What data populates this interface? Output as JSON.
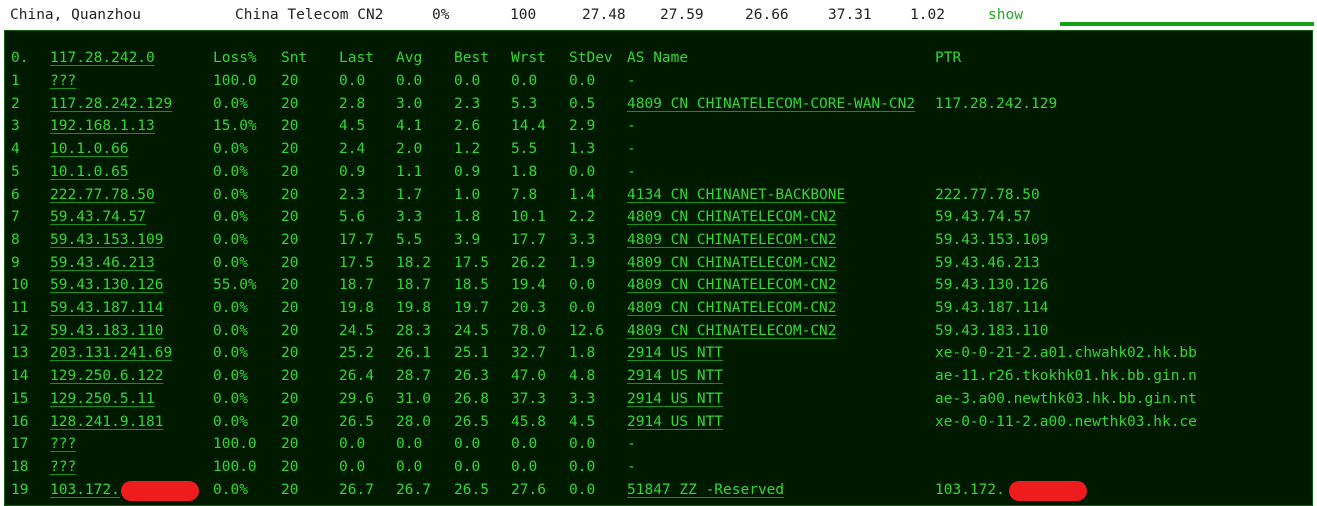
{
  "summary": {
    "location": "China, Quanzhou",
    "provider": "China Telecom CN2",
    "loss": "0%",
    "sent": "100",
    "last": "27.48",
    "avg": "27.59",
    "best": "26.66",
    "worst": "37.31",
    "stdev": "1.02",
    "show_label": "show",
    "accent": "#13a313"
  },
  "header": {
    "hop": "0.",
    "host": "117.28.242.0",
    "loss": "Loss%",
    "snt": "Snt",
    "last": "Last",
    "avg": "Avg",
    "best": "Best",
    "wrst": "Wrst",
    "stdev": "StDev",
    "asname": "AS Name",
    "ptr": "PTR"
  },
  "hops": [
    {
      "hop": "1",
      "host": "???",
      "loss": "100.0",
      "snt": "20",
      "last": "0.0",
      "avg": "0.0",
      "best": "0.0",
      "wrst": "0.0",
      "stdev": "0.0",
      "as": "-",
      "ptr": ""
    },
    {
      "hop": "2",
      "host": "117.28.242.129",
      "loss": "0.0%",
      "snt": "20",
      "last": "2.8",
      "avg": "3.0",
      "best": "2.3",
      "wrst": "5.3",
      "stdev": "0.5",
      "as": "4809  CN CHINATELECOM-CORE-WAN-CN2",
      "ptr": "117.28.242.129"
    },
    {
      "hop": "3",
      "host": "192.168.1.13",
      "loss": "15.0%",
      "snt": "20",
      "last": "4.5",
      "avg": "4.1",
      "best": "2.6",
      "wrst": "14.4",
      "stdev": "2.9",
      "as": "-",
      "ptr": ""
    },
    {
      "hop": "4",
      "host": "10.1.0.66",
      "loss": "0.0%",
      "snt": "20",
      "last": "2.4",
      "avg": "2.0",
      "best": "1.2",
      "wrst": "5.5",
      "stdev": "1.3",
      "as": "-",
      "ptr": ""
    },
    {
      "hop": "5",
      "host": "10.1.0.65",
      "loss": "0.0%",
      "snt": "20",
      "last": "0.9",
      "avg": "1.1",
      "best": "0.9",
      "wrst": "1.8",
      "stdev": "0.0",
      "as": "-",
      "ptr": ""
    },
    {
      "hop": "6",
      "host": "222.77.78.50",
      "loss": "0.0%",
      "snt": "20",
      "last": "2.3",
      "avg": "1.7",
      "best": "1.0",
      "wrst": "7.8",
      "stdev": "1.4",
      "as": "4134  CN CHINANET-BACKBONE",
      "ptr": "222.77.78.50"
    },
    {
      "hop": "7",
      "host": "59.43.74.57",
      "loss": "0.0%",
      "snt": "20",
      "last": "5.6",
      "avg": "3.3",
      "best": "1.8",
      "wrst": "10.1",
      "stdev": "2.2",
      "as": "4809  CN CHINATELECOM-CN2",
      "ptr": "59.43.74.57"
    },
    {
      "hop": "8",
      "host": "59.43.153.109",
      "loss": "0.0%",
      "snt": "20",
      "last": "17.7",
      "avg": "5.5",
      "best": "3.9",
      "wrst": "17.7",
      "stdev": "3.3",
      "as": "4809  CN CHINATELECOM-CN2",
      "ptr": "59.43.153.109"
    },
    {
      "hop": "9",
      "host": "59.43.46.213",
      "loss": "0.0%",
      "snt": "20",
      "last": "17.5",
      "avg": "18.2",
      "best": "17.5",
      "wrst": "26.2",
      "stdev": "1.9",
      "as": "4809  CN CHINATELECOM-CN2",
      "ptr": "59.43.46.213"
    },
    {
      "hop": "10",
      "host": "59.43.130.126",
      "loss": "55.0%",
      "snt": "20",
      "last": "18.7",
      "avg": "18.7",
      "best": "18.5",
      "wrst": "19.4",
      "stdev": "0.0",
      "as": "4809  CN CHINATELECOM-CN2",
      "ptr": "59.43.130.126"
    },
    {
      "hop": "11",
      "host": "59.43.187.114",
      "loss": "0.0%",
      "snt": "20",
      "last": "19.8",
      "avg": "19.8",
      "best": "19.7",
      "wrst": "20.3",
      "stdev": "0.0",
      "as": "4809  CN CHINATELECOM-CN2",
      "ptr": "59.43.187.114"
    },
    {
      "hop": "12",
      "host": "59.43.183.110",
      "loss": "0.0%",
      "snt": "20",
      "last": "24.5",
      "avg": "28.3",
      "best": "24.5",
      "wrst": "78.0",
      "stdev": "12.6",
      "as": "4809  CN CHINATELECOM-CN2",
      "ptr": "59.43.183.110"
    },
    {
      "hop": "13",
      "host": "203.131.241.69",
      "loss": "0.0%",
      "snt": "20",
      "last": "25.2",
      "avg": "26.1",
      "best": "25.1",
      "wrst": "32.7",
      "stdev": "1.8",
      "as": "2914  US NTT",
      "ptr": "xe-0-0-21-2.a01.chwahk02.hk.bb"
    },
    {
      "hop": "14",
      "host": "129.250.6.122",
      "loss": "0.0%",
      "snt": "20",
      "last": "26.4",
      "avg": "28.7",
      "best": "26.3",
      "wrst": "47.0",
      "stdev": "4.8",
      "as": "2914  US NTT",
      "ptr": "ae-11.r26.tkokhk01.hk.bb.gin.n"
    },
    {
      "hop": "15",
      "host": "129.250.5.11",
      "loss": "0.0%",
      "snt": "20",
      "last": "29.6",
      "avg": "31.0",
      "best": "26.8",
      "wrst": "37.3",
      "stdev": "3.3",
      "as": "2914  US NTT",
      "ptr": "ae-3.a00.newthk03.hk.bb.gin.nt"
    },
    {
      "hop": "16",
      "host": "128.241.9.181",
      "loss": "0.0%",
      "snt": "20",
      "last": "26.5",
      "avg": "28.0",
      "best": "26.5",
      "wrst": "45.8",
      "stdev": "4.5",
      "as": "2914  US NTT",
      "ptr": "xe-0-0-11-2.a00.newthk03.hk.ce"
    },
    {
      "hop": "17",
      "host": "???",
      "loss": "100.0",
      "snt": "20",
      "last": "0.0",
      "avg": "0.0",
      "best": "0.0",
      "wrst": "0.0",
      "stdev": "0.0",
      "as": "-",
      "ptr": ""
    },
    {
      "hop": "18",
      "host": "???",
      "loss": "100.0",
      "snt": "20",
      "last": "0.0",
      "avg": "0.0",
      "best": "0.0",
      "wrst": "0.0",
      "stdev": "0.0",
      "as": "-",
      "ptr": ""
    },
    {
      "hop": "19",
      "host": "103.172.",
      "loss": "0.0%",
      "snt": "20",
      "last": "26.7",
      "avg": "26.7",
      "best": "26.5",
      "wrst": "27.6",
      "stdev": "0.0",
      "as": "51847 ZZ -Reserved",
      "ptr": "103.172.",
      "redacted": true
    }
  ],
  "colors": {
    "text": "#36d636",
    "background": "#001a00",
    "redaction": "#ee1c1c"
  }
}
